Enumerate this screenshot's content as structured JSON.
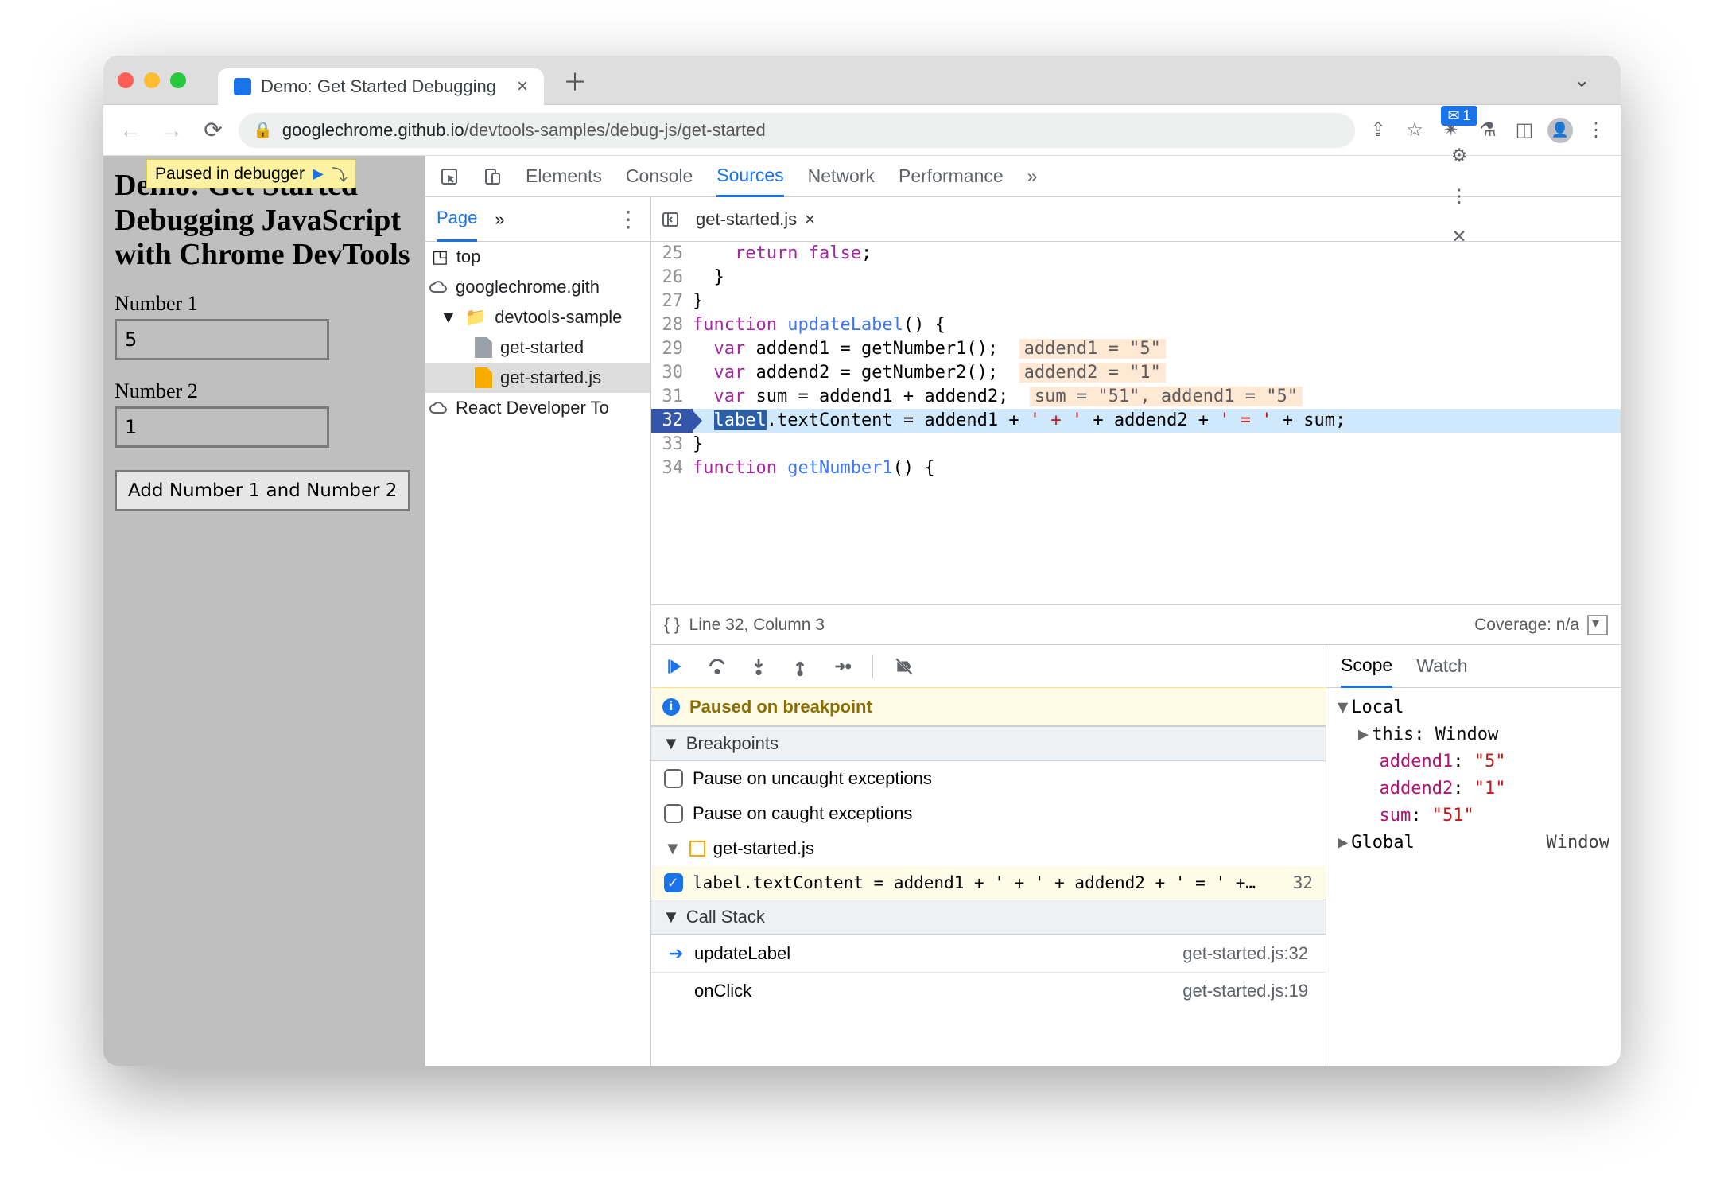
{
  "titlebar": {
    "tab_title": "Demo: Get Started Debugging"
  },
  "addr": {
    "host": "googlechrome.github.io",
    "path": "/devtools-samples/debug-js/get-started"
  },
  "page": {
    "paused_badge": "Paused in debugger",
    "h1": "Demo: Get Started Debugging JavaScript with Chrome DevTools",
    "label1": "Number 1",
    "val1": "5",
    "label2": "Number 2",
    "val2": "1",
    "button": "Add Number 1 and Number 2"
  },
  "devtools": {
    "tabs": [
      "Elements",
      "Console",
      "Sources",
      "Network",
      "Performance"
    ],
    "active_tab": "Sources",
    "messages_count": "1",
    "navigator": {
      "tab": "Page",
      "tree": {
        "top": "top",
        "domain": "googlechrome.gith",
        "folder": "devtools-sample",
        "file_html": "get-started",
        "file_js": "get-started.js",
        "ext": "React Developer To"
      }
    },
    "editor": {
      "file": "get-started.js",
      "lines": [
        {
          "n": 25,
          "html": "    <span class='kw'>return</span> <span class='kw'>false</span>;"
        },
        {
          "n": 26,
          "html": "  }"
        },
        {
          "n": 27,
          "html": "}"
        },
        {
          "n": 28,
          "html": "<span class='kw'>function</span> <span class='fn'>updateLabel</span>() {"
        },
        {
          "n": 29,
          "html": "  <span class='kw'>var</span> addend1 = getNumber1();  <span class='hint'>addend1 = \"5\"</span>"
        },
        {
          "n": 30,
          "html": "  <span class='kw'>var</span> addend2 = getNumber2();  <span class='hint'>addend2 = \"1\"</span>"
        },
        {
          "n": 31,
          "html": "  <span class='kw'>var</span> sum = addend1 + addend2;  <span class='hint'>sum = \"51\", addend1 = \"5\"</span>"
        },
        {
          "n": 32,
          "exec": true,
          "html": "  <span class='sel-tok'>label</span>.textContent = addend1 + <span class='str'>' + '</span> + addend2 + <span class='str'>' = '</span> + sum;"
        },
        {
          "n": 33,
          "html": "}"
        },
        {
          "n": 34,
          "html": "<span class='kw'>function</span> <span class='fn'>getNumber1</span>() {"
        }
      ],
      "status_pos": "Line 32, Column 3",
      "coverage": "Coverage: n/a"
    },
    "debugger": {
      "paused_msg": "Paused on breakpoint",
      "sections": {
        "breakpoints": "Breakpoints",
        "call_stack": "Call Stack"
      },
      "pause_uncaught": "Pause on uncaught exceptions",
      "pause_caught": "Pause on caught exceptions",
      "bp_file": "get-started.js",
      "bp_text": "label.textContent = addend1 + ' + ' + addend2 + ' = ' +…",
      "bp_line": "32",
      "stack": [
        {
          "name": "updateLabel",
          "loc": "get-started.js:32",
          "cur": true
        },
        {
          "name": "onClick",
          "loc": "get-started.js:19",
          "cur": false
        }
      ]
    },
    "scope": {
      "tabs": [
        "Scope",
        "Watch"
      ],
      "local": "Local",
      "this": "this",
      "this_val": "Window",
      "vars": [
        {
          "n": "addend1",
          "v": "\"5\""
        },
        {
          "n": "addend2",
          "v": "\"1\""
        },
        {
          "n": "sum",
          "v": "\"51\""
        }
      ],
      "global": "Global",
      "global_val": "Window"
    }
  }
}
